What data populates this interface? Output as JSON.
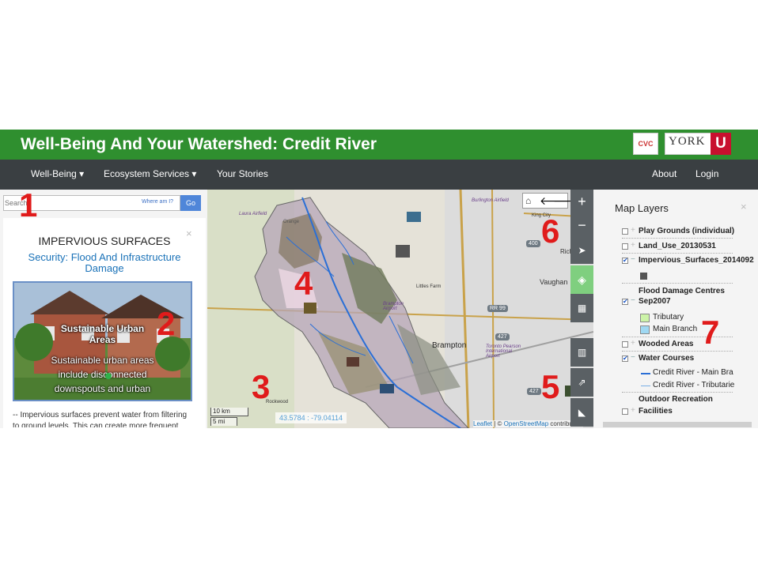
{
  "header": {
    "title": "Well-Being And Your Watershed: Credit River",
    "logo_cvc": "CVC",
    "logo_york": "YORK",
    "logo_u": "U"
  },
  "nav": {
    "well_being": "Well-Being ▾",
    "ecosystem": "Ecosystem Services ▾",
    "stories": "Your Stories",
    "about": "About",
    "login": "Login"
  },
  "search": {
    "placeholder": "Search",
    "where": "Where am I?",
    "go": "Go"
  },
  "popup": {
    "close": "×",
    "title": "IMPERVIOUS SURFACES",
    "subtitle": "Security: Flood And Infrastructure Damage",
    "image_title_1": "Sustainable Urban",
    "image_title_2": "Areas",
    "image_text_1": "Sustainable urban areas",
    "image_text_2": "include disconnected",
    "image_text_3": "downspouts and urban",
    "desc_1": "-- Impervious surfaces prevent water from filtering",
    "desc_2": "to ground levels. This can create more frequent"
  },
  "map": {
    "labels": {
      "laura": "Laura Airfield",
      "orange": "Orange",
      "vaughan": "Vaughan",
      "brampton": "Brampton",
      "brampton_airport": "Brampton Airport",
      "littles": "Littles Farm",
      "pearson": "Toronto Pearson International Airport",
      "rockwood": "Rockwood",
      "kingcity": "King City",
      "richmond": "Richmond",
      "rr99": "RR 99",
      "hwy400": "400",
      "hwy427a": "427",
      "hwy427b": "427",
      "burlington": "Burlington Airfield"
    },
    "scale_km": "10 km",
    "scale_mi": "5 mi",
    "coords": "43.5784 : -79.04114",
    "attribution_leaflet": "Leaflet",
    "attribution_rest": " | © ",
    "attribution_osm": "OpenStreetMap",
    "attribution_end": " contributors",
    "zoom_in": "+",
    "zoom_out": "−"
  },
  "layers": {
    "title": "Map Layers",
    "close": "×",
    "items": [
      {
        "label": "Play Grounds (individual)",
        "checked": false
      },
      {
        "label": "Land_Use_20130531",
        "checked": false
      },
      {
        "label": "Impervious_Surfaces_2014092",
        "checked": true
      },
      {
        "label": "Flood Damage Centres",
        "checked": true
      },
      {
        "label": "Sep2007",
        "checked": true
      },
      {
        "label": "Wooded Areas",
        "checked": false
      },
      {
        "label": "Water Courses",
        "checked": true
      },
      {
        "label": "Outdoor Recreation",
        "checked": false
      },
      {
        "label": "Facilities",
        "checked": false
      }
    ],
    "legend_tributary": "Tributary",
    "legend_main": "Main Branch",
    "water_main": "Credit River - Main Bra",
    "water_trib": "Credit River - Tributarie"
  },
  "annotations": [
    "1",
    "2",
    "3",
    "4",
    "5",
    "6",
    "7"
  ],
  "colors": {
    "header_green": "#2f8f2f",
    "nav_dark": "#3a3f42",
    "annotation_red": "#e01b1b",
    "link_blue": "#1a72b8"
  }
}
